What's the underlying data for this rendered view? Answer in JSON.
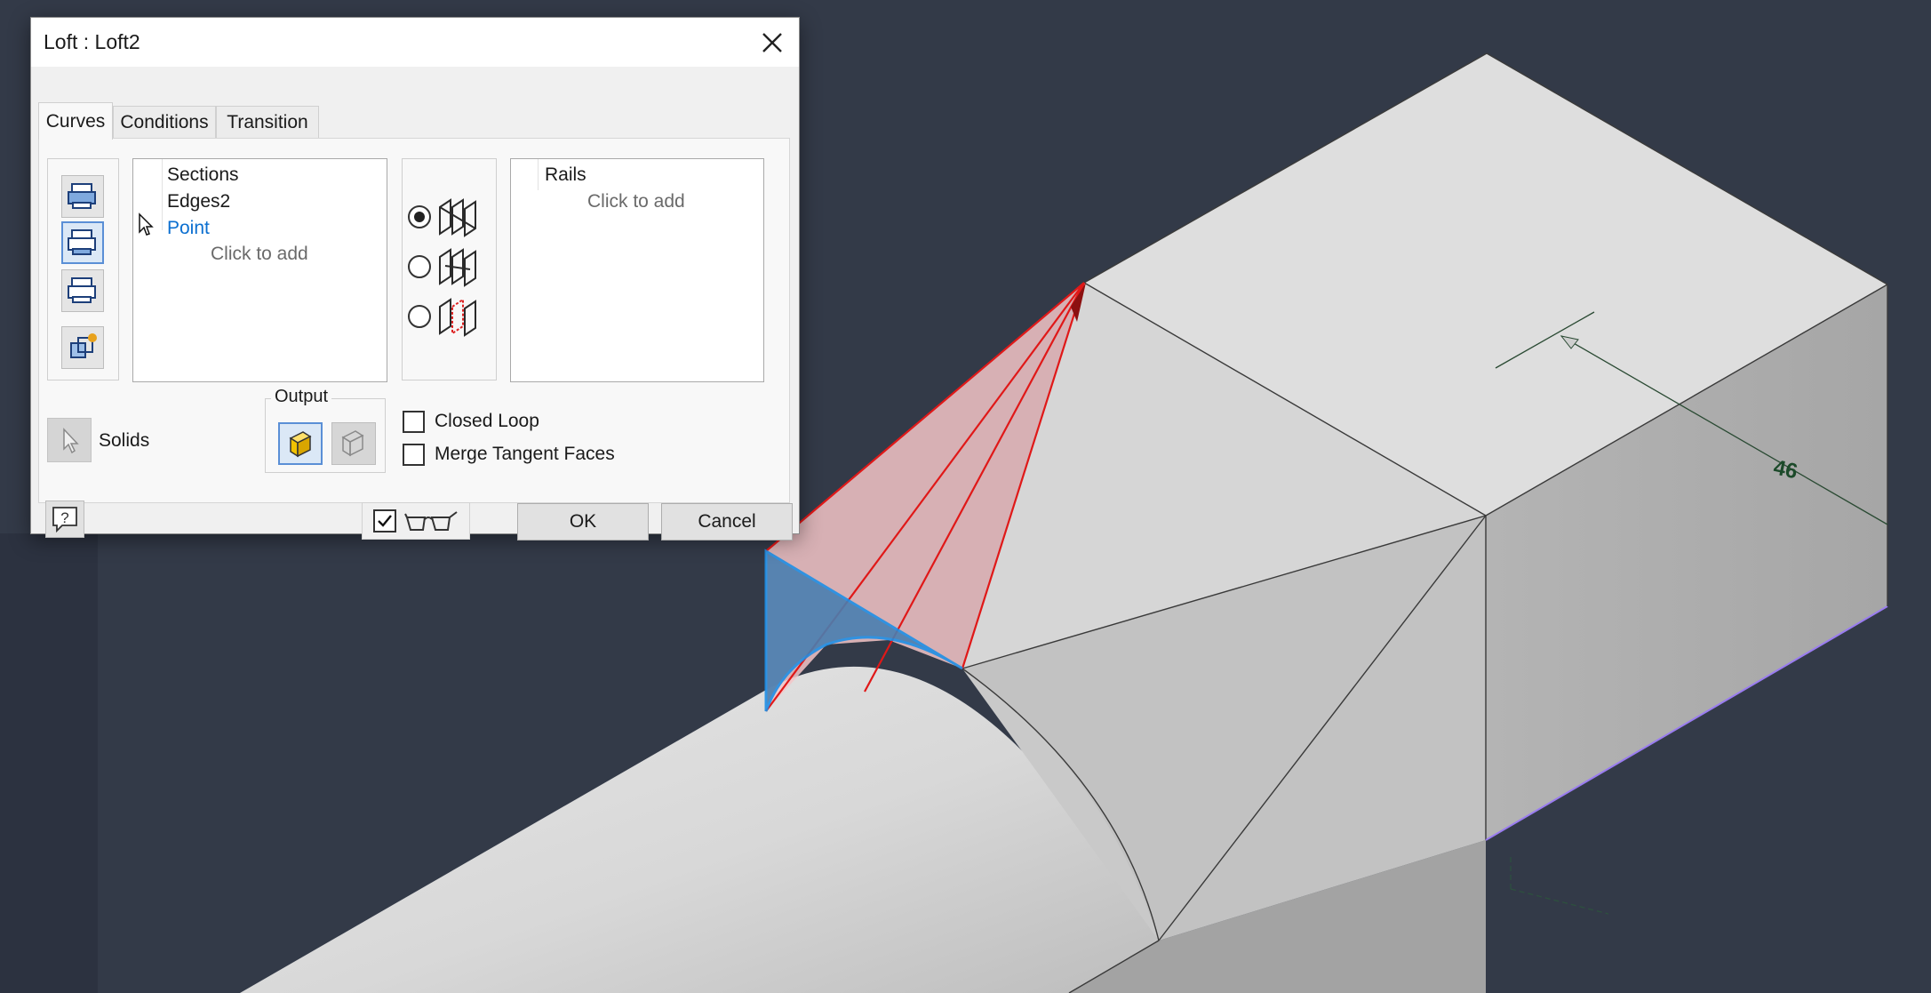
{
  "dialog": {
    "title": "Loft : Loft2",
    "tabs": [
      {
        "label": "Curves",
        "active": true
      },
      {
        "label": "Conditions",
        "active": false
      },
      {
        "label": "Transition",
        "active": false
      }
    ],
    "sections": {
      "header": "Sections",
      "items": [
        {
          "label": "Edges2",
          "color": "#1a1a1a"
        },
        {
          "label": "Point",
          "color": "#0b6fd0"
        }
      ],
      "add_prompt": "Click to add"
    },
    "rails": {
      "header": "Rails",
      "add_prompt": "Click to add"
    },
    "solids_label": "Solids",
    "output_label": "Output",
    "options": [
      {
        "label": "Closed Loop",
        "checked": false
      },
      {
        "label": "Merge Tangent Faces",
        "checked": false
      }
    ],
    "loft_type_selected": "rails",
    "preview_checked": true,
    "ok_label": "OK",
    "cancel_label": "Cancel"
  },
  "viewport": {
    "dimension_value": "46",
    "colors": {
      "background": "#333a48",
      "model_face": "#dcdcdc",
      "preview_fill": "#f4c6c8",
      "preview_edge": "#e01818",
      "selected_section": "#1e8fe6",
      "dimension": "#1c4a2a"
    }
  }
}
